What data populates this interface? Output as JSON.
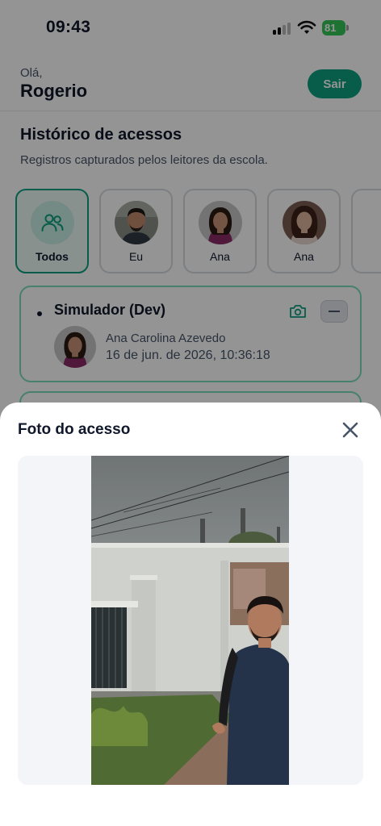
{
  "status_bar": {
    "time": "09:43",
    "battery": "81"
  },
  "header": {
    "greeting": "Olá,",
    "user_name": "Rogerio",
    "logout_label": "Sair"
  },
  "history": {
    "title": "Histórico de acessos",
    "subtitle": "Registros capturados pelos leitores da escola."
  },
  "filters": [
    {
      "label": "Todos",
      "icon": "users-icon",
      "active": true
    },
    {
      "label": "Eu",
      "avatar": "man-avatar"
    },
    {
      "label": "Ana",
      "avatar": "girl-avatar"
    },
    {
      "label": "Ana",
      "avatar": "woman-avatar"
    }
  ],
  "access_entries": [
    {
      "reader": "Simulador (Dev)",
      "person": "Ana Carolina Azevedo",
      "timestamp": "16 de jun. de 2026, 10:36:18"
    }
  ],
  "photo_sheet": {
    "title": "Foto do acesso"
  },
  "colors": {
    "accent": "#0e9f80",
    "accent_light": "#7ddcbf",
    "overlay": "rgba(0,0,0,0.42)"
  }
}
